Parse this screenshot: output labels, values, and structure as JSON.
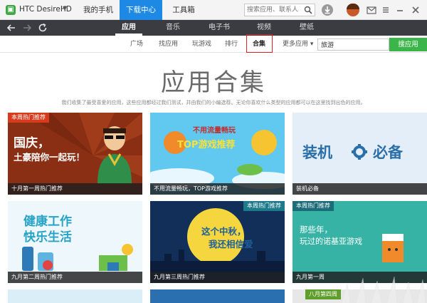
{
  "titlebar": {
    "device_name": "HTC DesireHD",
    "tabs": [
      "我的手机",
      "下载中心",
      "工具箱"
    ],
    "active_tab": 1,
    "search_placeholder": "搜索应用、联系人"
  },
  "toolbar": {
    "categories": [
      "应用",
      "音乐",
      "电子书",
      "视频",
      "壁纸"
    ],
    "active_category": 0
  },
  "subnav": {
    "items": [
      "广场",
      "找应用",
      "玩游戏",
      "排行",
      "合集",
      "更多应用 ▾"
    ],
    "active_item": 4,
    "search_value": "旅游",
    "search_button": "搜应用"
  },
  "header": {
    "title": "应用合集",
    "description": "我们收集了最受喜爱的应用，这些应用都经过我们测试，并由我们的小编选荐。无论你喜欢什么类型的应用都可以在这里找到出色的应用。"
  },
  "cards": [
    {
      "badge": "本周热门推荐",
      "lines": [
        "国庆，",
        "土豪陪你一起玩！"
      ],
      "caption": "十月第一周热门推荐"
    },
    {
      "badge": "",
      "lines": [
        "不用流量畅玩",
        "TOP游戏推荐"
      ],
      "caption": "不用流量畅玩，TOP游戏推荐"
    },
    {
      "badge": "",
      "lines": [
        "装机",
        "必备"
      ],
      "caption": "装机必备"
    },
    {
      "badge": "",
      "lines": [
        "健康工作",
        "快乐生活"
      ],
      "caption": "九月第二周热门推荐"
    },
    {
      "badge": "本周热门推荐",
      "lines": [
        "这个中秋，",
        "我还相信爱"
      ],
      "caption": "九月第三周热门推荐"
    },
    {
      "badge": "本周热门推荐",
      "lines": [
        "那些年，",
        "玩过的诺基亚游戏"
      ],
      "caption": "九月第一周"
    },
    {
      "badge": "",
      "lines": [],
      "caption": ""
    },
    {
      "badge": "",
      "lines": [],
      "caption": ""
    },
    {
      "badge": "八月第四周",
      "lines": [],
      "caption": ""
    }
  ],
  "colors": {
    "accent_blue": "#1e88e5",
    "search_green": "#3bb54a",
    "toolbar_dark": "#3a3c41",
    "badge_red": "#d63b1e"
  }
}
